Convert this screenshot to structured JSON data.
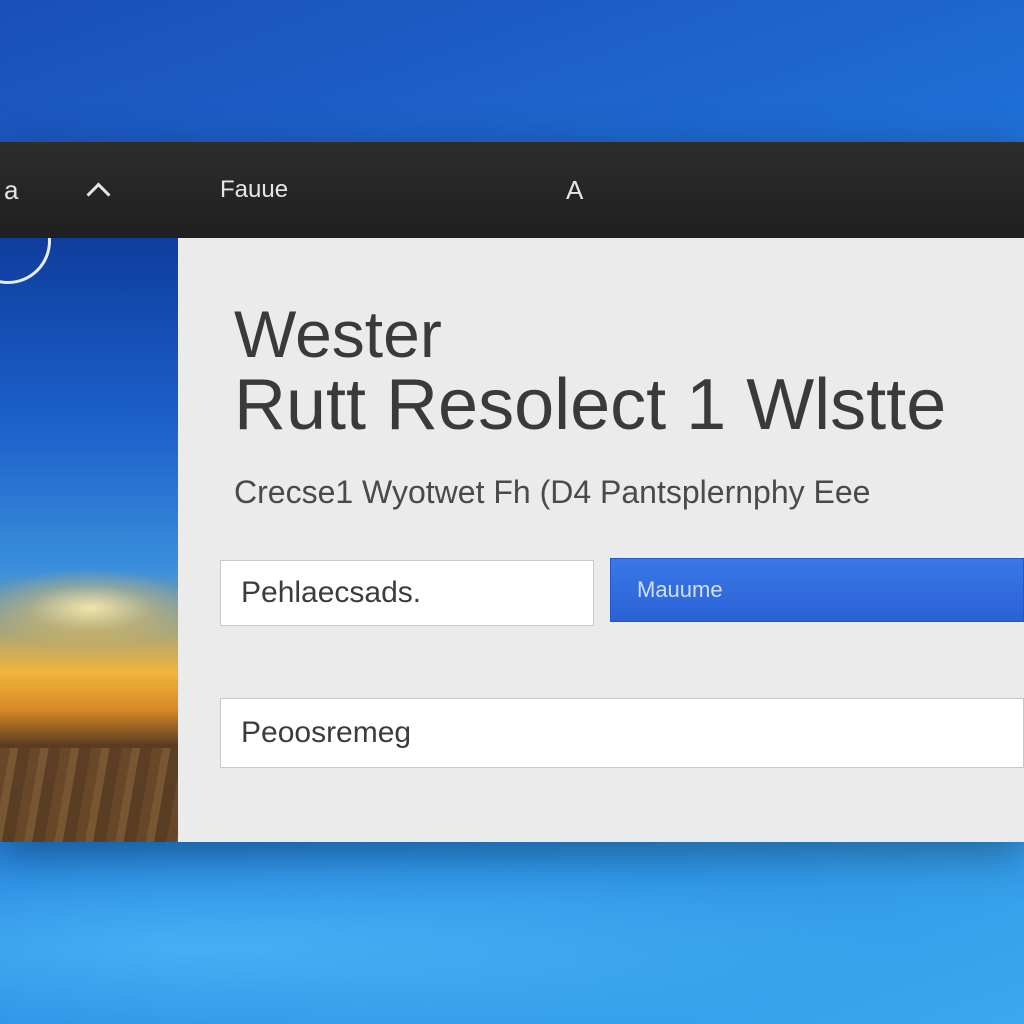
{
  "titlebar": {
    "left_glyph": "a",
    "title": "Fauue",
    "right_glyph": "A"
  },
  "main": {
    "headline_line1": "Wester",
    "headline_line2": "Rutt Resolect 1  Wlstte",
    "subtitle": "Crecse1 Wyotwet  Fh (D4  Pantsplernphy  Eee"
  },
  "form": {
    "field1_value": "Pehlaecsads.",
    "button_label": "Mauume",
    "field2_value": "Peoosremeg"
  },
  "colors": {
    "titlebar": "#1f1f1f",
    "content_bg": "#ebebeb",
    "accent_button": "#2a62d6",
    "desktop": "#1f6fd6"
  }
}
